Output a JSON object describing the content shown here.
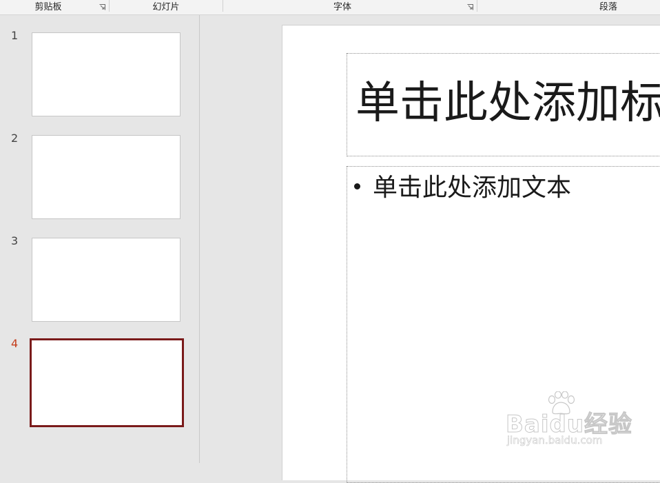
{
  "ribbon": {
    "groups": [
      "剪贴板",
      "幻灯片",
      "字体",
      "段落"
    ]
  },
  "thumbnails": {
    "slides": [
      {
        "number": "1",
        "active": false
      },
      {
        "number": "2",
        "active": false
      },
      {
        "number": "3",
        "active": false
      },
      {
        "number": "4",
        "active": true
      }
    ]
  },
  "slide": {
    "title_placeholder": "单击此处添加标题",
    "body_bullet": "单击此处添加文本"
  },
  "watermark": {
    "brand": "Baidu经验",
    "url": "jingyan.baidu.com"
  },
  "colors": {
    "active_thumb_border": "#7a1a1a",
    "active_thumb_number": "#c43e1c"
  },
  "icons": {
    "dialog_launcher": "dialog-launcher-icon",
    "bullet": "bullet-icon",
    "watermark_logo": "baidu-paw-icon"
  }
}
